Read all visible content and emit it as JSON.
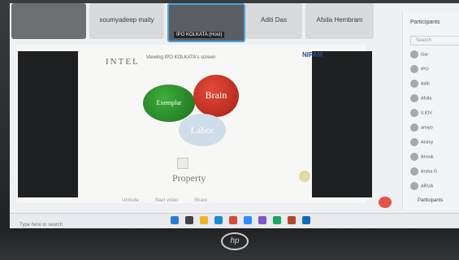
{
  "thumbnails": [
    {
      "name": ""
    },
    {
      "name": "soumyadeep maity"
    },
    {
      "name": "IPO KOLKATA (Host)"
    },
    {
      "name": "Aditi Das"
    },
    {
      "name": "Afsila Hembram"
    }
  ],
  "banner": "Viewing IPO KOLKATA's screen",
  "slide": {
    "title": "INTEL",
    "title_tail": "N",
    "brand": "NIPAM",
    "circles": [
      "Exemplar",
      "Brain",
      "Labor"
    ],
    "property": "Property"
  },
  "toolbar": {
    "items": [
      "Unmute",
      "Start video",
      "Share"
    ]
  },
  "participants": {
    "title": "Participants",
    "search_placeholder": "Search",
    "rows": [
      "Gar",
      "IPO",
      "Aditi",
      "Afsila",
      "ILIOV",
      "amiyo",
      "Animy",
      "Anouk",
      "Arsha G",
      "ARUA",
      "ASHA R"
    ],
    "footer": "Participants"
  },
  "taskbar": {
    "search_placeholder": "Type here to search"
  },
  "monitor": {
    "logo": "hp"
  },
  "colors": {
    "brain": "#c8271f",
    "exemplar": "#2b8f2a",
    "labor": "#c9dbe8",
    "end_call": "#e2534a"
  }
}
